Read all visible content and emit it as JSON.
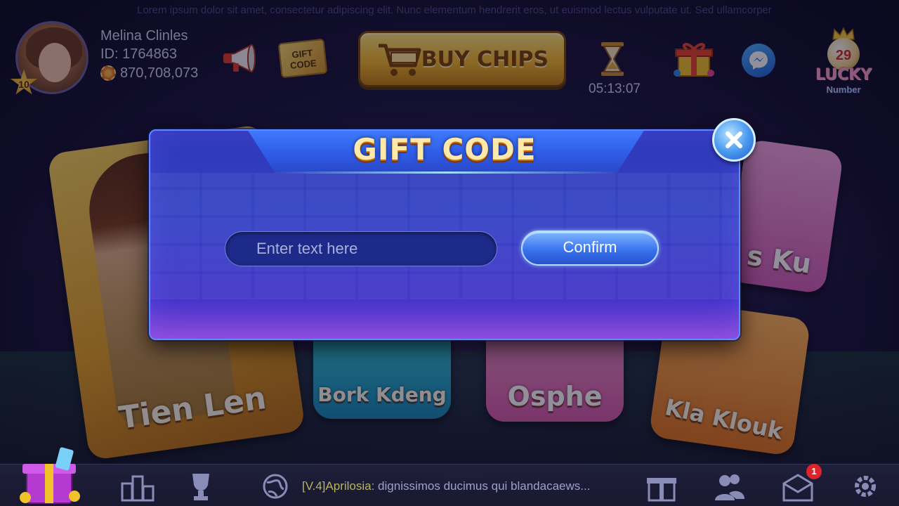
{
  "marquee": "Lorem ipsum dolor sit amet, consectetur adipiscing elit. Nunc elementum hendrerit eros, ut euismod lectus vulputate ut. Sed ullamcorper",
  "user": {
    "name": "Melina Clinles",
    "id": "ID: 1764863",
    "chips": "870,708,073",
    "level": "10"
  },
  "toolbar": {
    "gift_code_icon_text": "GIFT CODE",
    "buy_chips_label": "BUY CHIPS",
    "timer": "05:13:07",
    "lucky_number_ball": "29",
    "lucky_title": "LUCKY",
    "lucky_sub": "Number"
  },
  "games": [
    {
      "label": "Tien Len"
    },
    {
      "label": "Bork Kdeng"
    },
    {
      "label": "Osphe"
    },
    {
      "label": "Kla Klouk"
    },
    {
      "label": "s Ku"
    }
  ],
  "modal": {
    "title": "GIFT CODE",
    "input_placeholder": "Enter text here",
    "confirm_label": "Confirm"
  },
  "bottom": {
    "news_tag": "[V.4]Aprilosia",
    "news_text": ": dignissimos ducimus qui blandacaews...",
    "mail_badge": "1"
  },
  "colors": {
    "modal_bg": "#3140c4",
    "modal_border": "#5e8cff",
    "buy_chips_gold": "#f6b72b",
    "title_gold": "#ffe9a8",
    "badge_red": "#e0222a"
  }
}
